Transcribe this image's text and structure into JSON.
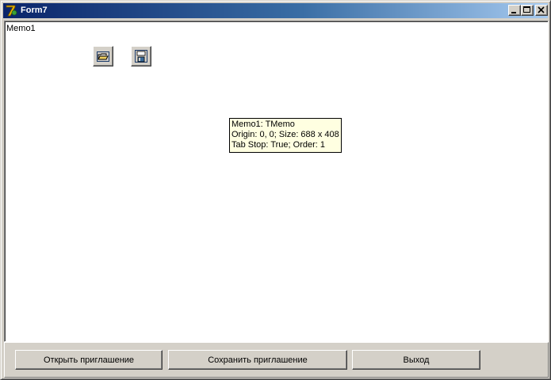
{
  "window": {
    "title": "Form7",
    "icon": "delphi-app-icon",
    "controls": {
      "minimize_icon": "minimize-icon",
      "maximize_icon": "maximize-icon",
      "close_icon": "close-icon"
    }
  },
  "memo": {
    "text": "Memo1"
  },
  "dialogs": {
    "open_icon": "open-dialog-icon",
    "save_icon": "save-dialog-icon"
  },
  "hint": {
    "line1": "Memo1: TMemo",
    "line2": "Origin: 0, 0; Size: 688 x 408",
    "line3": "Tab Stop: True; Order: 1"
  },
  "buttons": {
    "open_label": "Открыть приглашение",
    "save_label": "Сохранить приглашение",
    "exit_label": "Выход"
  },
  "colors": {
    "titlebar_start": "#0a246a",
    "titlebar_end": "#a6caf0",
    "face": "#d4d0c8",
    "hint_bg": "#ffffe1"
  }
}
